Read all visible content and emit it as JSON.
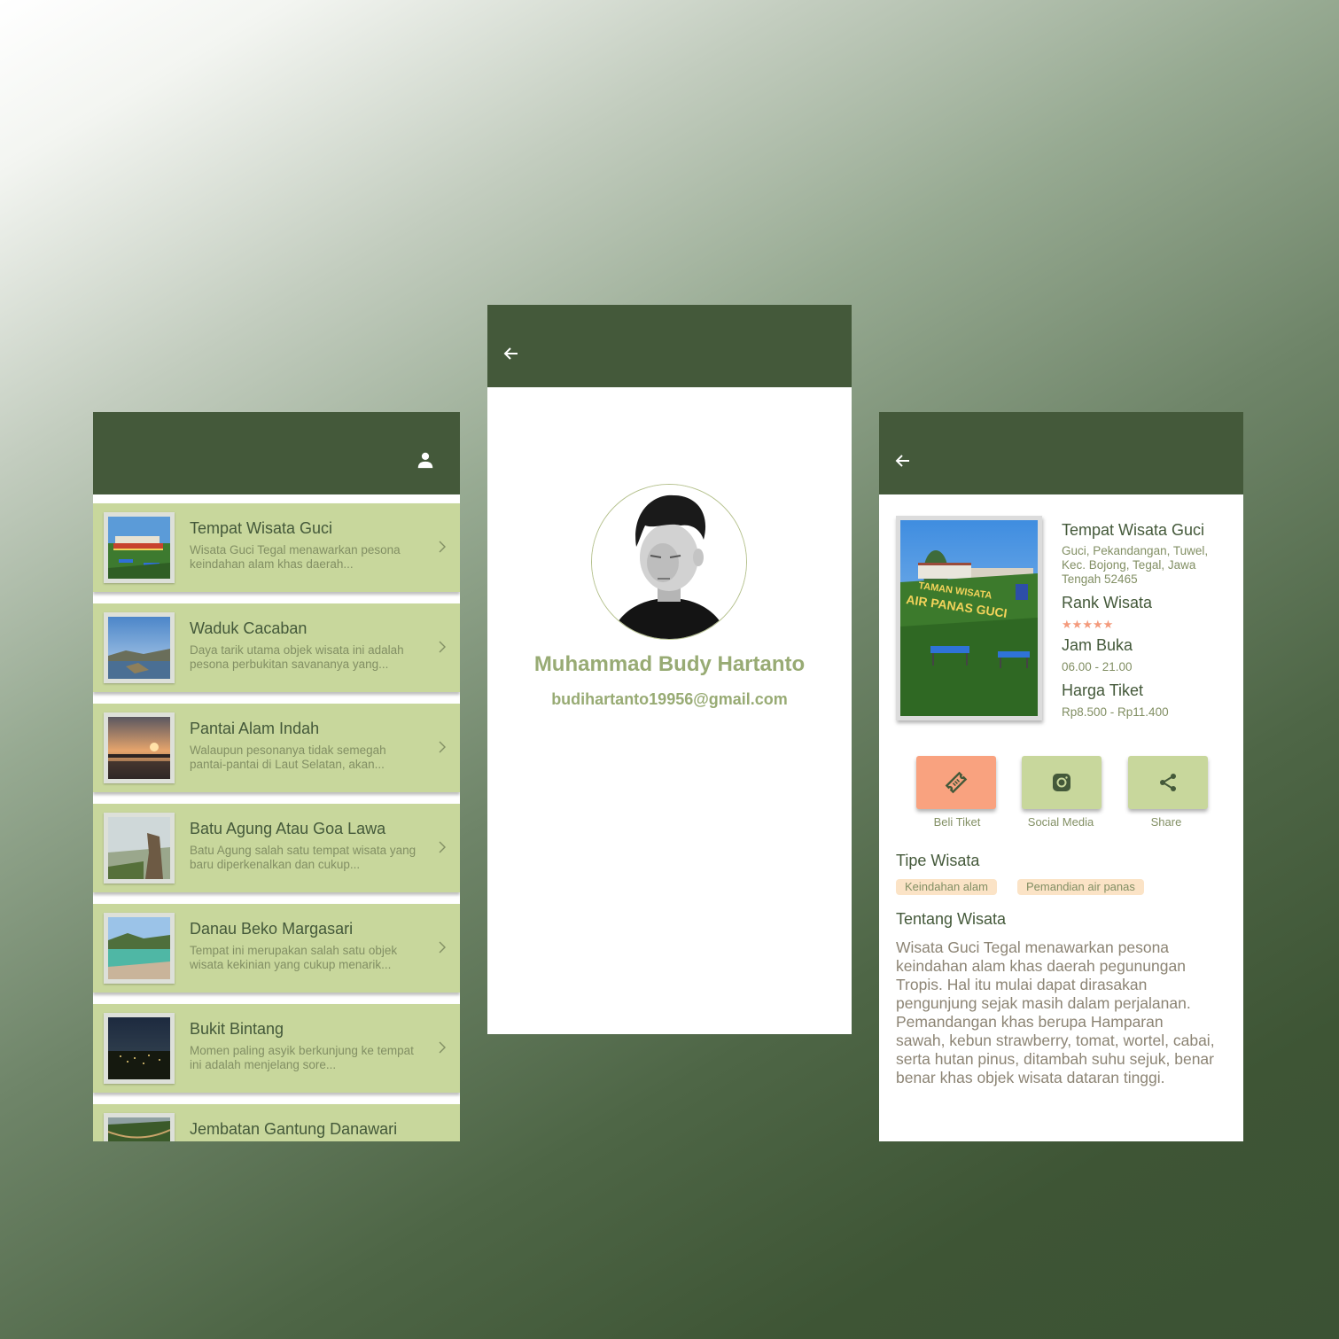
{
  "list_screen": {
    "items": [
      {
        "title": "Tempat Wisata Guci",
        "desc": "Wisata Guci Tegal menawarkan pesona keindahan alam khas daerah..."
      },
      {
        "title": "Waduk Cacaban",
        "desc": "Daya tarik utama objek wisata ini adalah pesona perbukitan savananya yang..."
      },
      {
        "title": "Pantai Alam Indah",
        "desc": "Walaupun pesonanya tidak semegah pantai-pantai di Laut Selatan, akan..."
      },
      {
        "title": "Batu Agung Atau Goa Lawa",
        "desc": "Batu Agung salah satu tempat wisata yang baru diperkenalkan dan cukup..."
      },
      {
        "title": "Danau Beko Margasari",
        "desc": "Tempat ini merupakan salah satu objek wisata kekinian yang cukup menarik..."
      },
      {
        "title": "Bukit Bintang",
        "desc": "Momen paling asyik berkunjung ke tempat ini adalah menjelang sore..."
      },
      {
        "title": "Jembatan Gantung Danawari",
        "desc": ""
      }
    ],
    "icons": {
      "profile": "person-icon",
      "chevron": "chevron-right-icon"
    }
  },
  "profile_screen": {
    "name": "Muhammad Budy Hartanto",
    "email": "budihartanto19956@gmail.com"
  },
  "detail_screen": {
    "title": "Tempat Wisata Guci",
    "address": "Guci, Pekandangan, Tuwel, Kec. Bojong, Tegal, Jawa Tengah 52465",
    "photo_sign_line1": "TAMAN WISATA",
    "photo_sign_line2": "AIR PANAS GUCI",
    "rank_label": "Rank Wisata",
    "rating": 5,
    "hours_label": "Jam Buka",
    "hours": "06.00 - 21.00",
    "price_label": "Harga Tiket",
    "price": "Rp8.500 - Rp11.400",
    "actions": [
      {
        "label": "Beli Tiket",
        "icon": "ticket-icon",
        "color": "#f9a27f"
      },
      {
        "label": "Social Media",
        "icon": "instagram-icon",
        "color": "#c8d79c"
      },
      {
        "label": "Share",
        "icon": "share-icon",
        "color": "#c8d79c"
      }
    ],
    "type_label": "Tipe Wisata",
    "types": [
      "Keindahan alam",
      "Pemandian air panas"
    ],
    "about_label": "Tentang Wisata",
    "about": "Wisata Guci Tegal menawarkan pesona keindahan alam khas daerah pegunungan Tropis. Hal itu mulai dapat dirasakan pengunjung sejak masih dalam perjalanan. Pemandangan khas berupa Hamparan sawah, kebun strawberry, tomat, wortel, cabai, serta hutan pinus, ditambah suhu sejuk, benar benar khas objek wisata dataran tinggi."
  },
  "colors": {
    "appbar": "#44593a",
    "card": "#c8d79c",
    "accent_orange": "#f9a27f",
    "text_dark_green": "#44593a",
    "text_muted": "#828f64",
    "profile_text": "#98ab74",
    "chip": "#fbe3c6"
  }
}
